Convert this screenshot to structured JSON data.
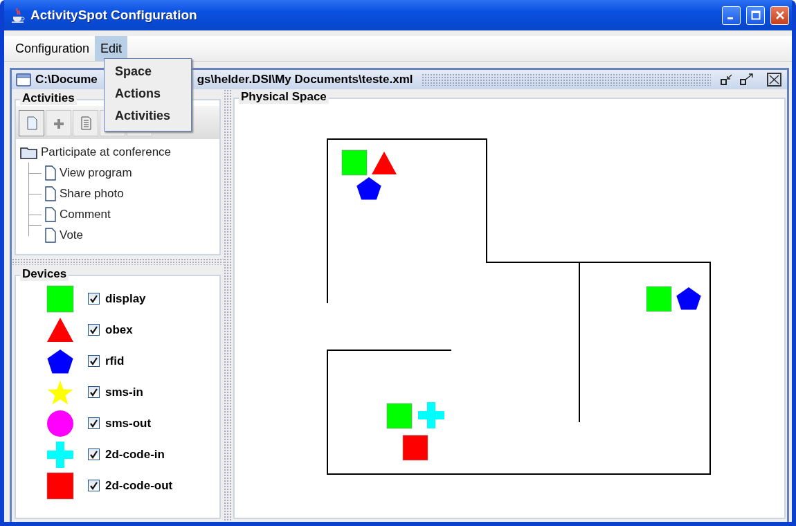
{
  "window": {
    "title": "ActivitySpot Configuration"
  },
  "menu_bar": [
    {
      "label": "Configuration",
      "selected": false
    },
    {
      "label": "Edit",
      "selected": true
    }
  ],
  "open_menu": [
    "Space",
    "Actions",
    "Activities"
  ],
  "document": {
    "title_parts": [
      "C:\\Docume",
      "gs\\helder.DSI\\My Documents\\teste.xml"
    ]
  },
  "activities": {
    "title": "Activities",
    "tree": [
      {
        "label": "Participate at conference",
        "kind": "folder",
        "children": [
          {
            "label": "View program",
            "kind": "file"
          },
          {
            "label": "Share photo",
            "kind": "file"
          },
          {
            "label": "Comment",
            "kind": "file"
          },
          {
            "label": "Vote",
            "kind": "file"
          }
        ]
      }
    ]
  },
  "devices": {
    "title": "Devices",
    "items": [
      {
        "label": "display",
        "kind": "square",
        "color": "#00ff00",
        "checked": true
      },
      {
        "label": "obex",
        "kind": "triangle",
        "color": "#ff0000",
        "checked": true
      },
      {
        "label": "rfid",
        "kind": "pentagon",
        "color": "#0000ff",
        "checked": true
      },
      {
        "label": "sms-in",
        "kind": "star",
        "color": "#ffff00",
        "checked": true
      },
      {
        "label": "sms-out",
        "kind": "circle",
        "color": "#ff00ff",
        "checked": true
      },
      {
        "label": "2d-code-in",
        "kind": "cross",
        "color": "#00ffff",
        "checked": true
      },
      {
        "label": "2d-code-out",
        "kind": "square",
        "color": "#ff0000",
        "checked": true
      }
    ]
  },
  "space": {
    "title": "Physical Space",
    "rooms": [
      {
        "devices": [
          {
            "kind": "square",
            "color": "#00ff00"
          },
          {
            "kind": "triangle",
            "color": "#ff0000"
          },
          {
            "kind": "pentagon",
            "color": "#0000ff"
          }
        ]
      },
      {
        "devices": [
          {
            "kind": "square",
            "color": "#00ff00"
          },
          {
            "kind": "pentagon",
            "color": "#0000ff"
          }
        ]
      },
      {
        "devices": [
          {
            "kind": "square",
            "color": "#00ff00"
          },
          {
            "kind": "cross",
            "color": "#00ffff"
          },
          {
            "kind": "square",
            "color": "#ff0000"
          }
        ]
      }
    ]
  }
}
